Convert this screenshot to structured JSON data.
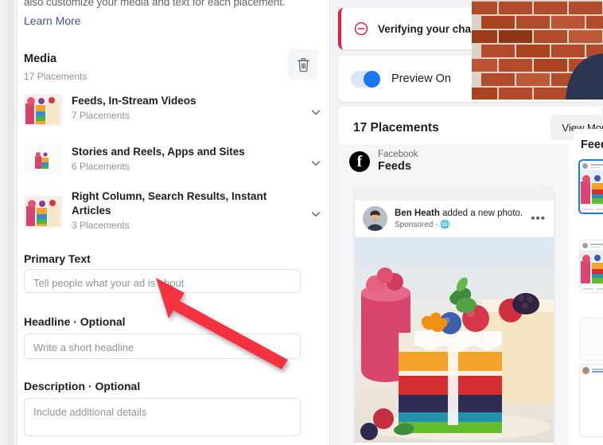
{
  "editor": {
    "intro_text": "also customize your media and text for each placement.",
    "learn_more": "Learn More",
    "media_section": {
      "title": "Media",
      "subtitle": "17 Placements",
      "delete_icon": "trash-icon"
    },
    "placements": [
      {
        "name": "Feeds, In-Stream Videos",
        "count": "7 Placements",
        "chevron": "chevron-down-icon"
      },
      {
        "name": "Stories and Reels, Apps and Sites",
        "count": "6 Placements",
        "chevron": "chevron-down-icon"
      },
      {
        "name": "Right Column, Search Results, Instant Articles",
        "count": "3 Placements",
        "chevron": "chevron-down-icon"
      }
    ],
    "fields": [
      {
        "label": "Primary Text",
        "placeholder": "Tell people what your ad is about",
        "value": ""
      },
      {
        "label": "Headline · Optional",
        "placeholder": "Write a short headline",
        "value": ""
      },
      {
        "label": "Description · Optional",
        "placeholder": "Include additional details",
        "value": ""
      }
    ]
  },
  "preview": {
    "alert": {
      "icon": "error-circle-icon",
      "text": "Verifying your chang"
    },
    "toggle": {
      "label": "Preview On",
      "state": "on",
      "accent_color": "#1877f2"
    },
    "placements_header": {
      "count_label": "17 Placements",
      "view_more_label": "View More"
    },
    "platform": {
      "logo_icon": "facebook-logo-icon",
      "network": "Facebook",
      "surface": "Feeds"
    },
    "ad_card": {
      "advertiser": "Ben Heath",
      "action_text": " added a new photo.",
      "sponsored_label": "Sponsored",
      "globe_icon": "globe-icon",
      "menu_icon": "ellipsis-icon",
      "image_alt": "rainbow-layer-cake"
    },
    "thumbnail_rail": {
      "title": "Feeds",
      "selected_index": 0,
      "selected_border_color": "#1877f2",
      "cards": 3
    }
  },
  "overlay": {
    "webcam": {
      "name": "webcam-presenter-overlay",
      "background": "brick-wall",
      "subject": "presenter-shoulder"
    },
    "annotation_arrow": {
      "name": "red-annotation-arrow",
      "color": "#f5333f",
      "points_to": "primary-text-input"
    }
  }
}
